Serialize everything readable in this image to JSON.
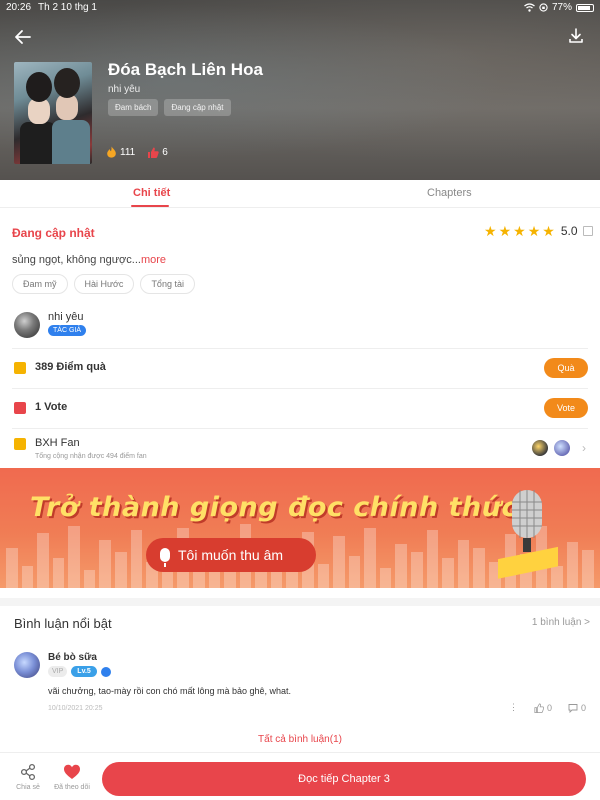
{
  "status_bar": {
    "time": "20:26",
    "date": "Th 2 10 thg 1",
    "battery": "77%"
  },
  "book": {
    "title": "Đóa Bạch Liên Hoa",
    "author": "nhi yêu",
    "tags": [
      "Đam bách",
      "Đang cập nhật"
    ],
    "likes": "111",
    "reactions": "6"
  },
  "tabs": [
    {
      "label": "Chi tiết",
      "active": true
    },
    {
      "label": "Chapters",
      "active": false
    }
  ],
  "detail": {
    "status": "Đang cập nhật",
    "rating": "5.0",
    "description": "sủng ngọt, không ngược...",
    "more": "more",
    "genres": [
      "Đam mỹ",
      "Hài Hước",
      "Tổng tài"
    ],
    "author_name": "nhi yêu",
    "author_badge": "TÁC GIẢ"
  },
  "rows": {
    "gift": {
      "label": "389 Điểm quà",
      "button": "Quà"
    },
    "vote": {
      "label": "1 Vote",
      "button": "Vote"
    },
    "fan": {
      "label": "BXH Fan",
      "sub": "Tổng cộng nhận được 494 điểm fan"
    }
  },
  "banner": {
    "title": "Trở thành giọng đọc chính thức!",
    "button": "Tôi muốn thu âm"
  },
  "comments": {
    "heading": "Bình luận nổi bật",
    "count": "1 bình luận >",
    "items": [
      {
        "name": "Bé bò sữa",
        "vip": "VIP",
        "level": "Lv.5",
        "text": "vãi chưởng, tao-mày rồi con chó mất lông mà bảo ghê, what.",
        "date": "10/10/2021 20:25",
        "likes": "0",
        "replies": "0"
      }
    ],
    "all_link": "Tất cả bình luận(1)"
  },
  "bottom": {
    "share": "Chia sẻ",
    "follow": "Đã theo dõi",
    "cta": "Đọc tiếp Chapter 3"
  },
  "colors": {
    "accent": "#e8454b",
    "orange": "#f28a1a",
    "star": "#f5b301",
    "banner": "#f06a4f"
  }
}
